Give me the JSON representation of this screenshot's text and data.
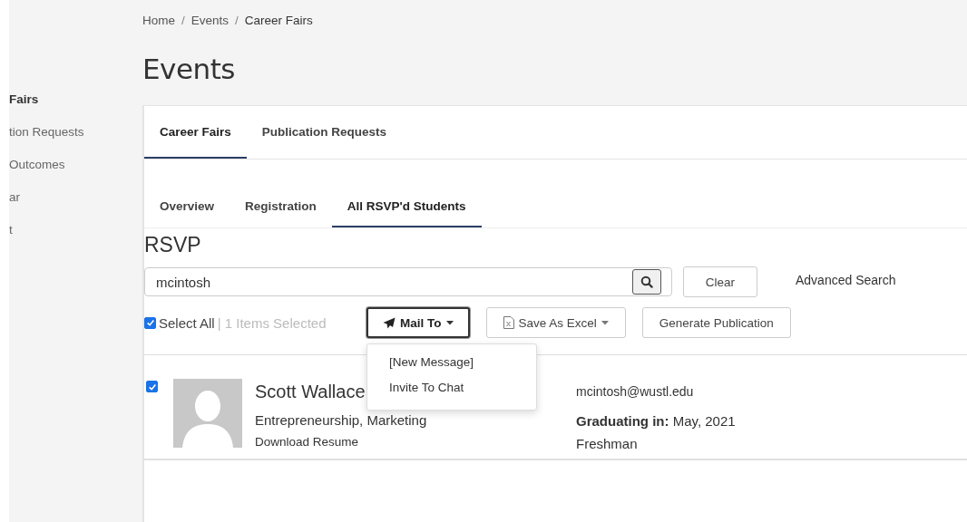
{
  "sidebar": {
    "items": [
      {
        "label": "Fairs",
        "selected": true
      },
      {
        "label": "tion Requests",
        "selected": false
      },
      {
        "label": "Outcomes",
        "selected": false
      },
      {
        "label": "ar",
        "selected": false
      },
      {
        "label": "t",
        "selected": false
      }
    ]
  },
  "breadcrumb": [
    "Home",
    "Events",
    "Career Fairs"
  ],
  "separator": "/",
  "page_title": "Events",
  "tabs": [
    {
      "label": "Career Fairs",
      "selected": true
    },
    {
      "label": "Publication Requests",
      "selected": false
    }
  ],
  "subtabs": [
    {
      "label": "Overview",
      "selected": false
    },
    {
      "label": "Registration",
      "selected": false
    },
    {
      "label": "All RSVP'd Students",
      "selected": true
    }
  ],
  "section_title": "RSVP",
  "search": {
    "value": "mcintosh"
  },
  "clear_button": "Clear",
  "advanced_search": "Advanced Search",
  "select_all": {
    "label": "Select All",
    "checked": true,
    "count": "| 1 Items Selected"
  },
  "mail_button": {
    "label": "Mail To",
    "expanded": true,
    "menu": [
      "[New Message]",
      "Invite To Chat"
    ]
  },
  "excel_button": "Save As Excel",
  "generate_button": "Generate Publication",
  "students": [
    {
      "checked": true,
      "name": "Scott Wallace",
      "majors": "Entrepreneurship, Marketing",
      "resume": "Download Resume",
      "email": "mcintosh@wustl.edu",
      "graduating_label": "Graduating in:",
      "graduating": "May, 2021",
      "year": "Freshman"
    }
  ]
}
